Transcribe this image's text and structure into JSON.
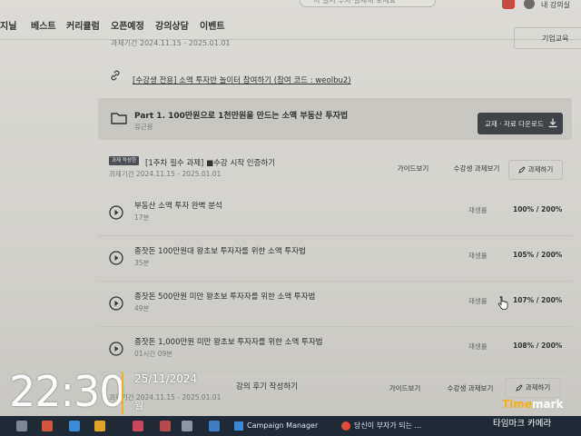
{
  "nav": {
    "items": [
      "지닐",
      "베스트",
      "커리큘럼",
      "오픈예정",
      "강의상담",
      "이벤트"
    ],
    "search_placeholder": "이 일시 투자 실제해 보세요",
    "username": "내 강의실"
  },
  "top_task": {
    "period": "과제기간 2024.11.15 - 2025.01.01",
    "corp_button": "기업교육"
  },
  "event_link": "[수강생 전용] 소액 투자반 놀이터 참여하기 (참여 코드 : weolbu2)",
  "part": {
    "title": "Part 1. 100만원으로 1천만원을 만드는 소액 부동산 투자법",
    "subtitle": "유근용",
    "download_label": "교재 · 자료 다운로드"
  },
  "task1": {
    "badge": "과제 작성한",
    "title": "[1주차 필수 과제] ■수강 시작 인증하기",
    "period": "과제기간 2024.11.15 - 2025.01.01",
    "guide_label": "가이드보기",
    "view_label": "수강생 과제보기",
    "submit_label": "과제하기"
  },
  "lessons": [
    {
      "title": "부동산 소액 투자 완벽 분석",
      "duration": "17분",
      "replay": "재생률",
      "rate": "100% / 200%"
    },
    {
      "title": "종잣돈 100만원대 왕초보 투자자를 위한 소액 투자법",
      "duration": "35분",
      "replay": "재생률",
      "rate": "105% / 200%"
    },
    {
      "title": "종잣돈 500만원 미만 왕초보 투자자를 위한 소액 투자법",
      "duration": "49분",
      "replay": "재생률",
      "rate": "107% / 200%"
    },
    {
      "title": "종잣돈 1,000만원 미만 왕초보 투자자를 위한 소액 투자법",
      "duration": "01시간 09분",
      "replay": "재생률",
      "rate": "108% / 200%"
    }
  ],
  "task2": {
    "title": "강의 후기 작성하기",
    "period": "과제기간 2024.11.15 - 2025.01.01",
    "guide_label": "가이드보기",
    "view_label": "수강생 과제보기",
    "submit_label": "과제하기"
  },
  "taskbar": {
    "app1": "Campaign Manager",
    "app2": "당신이 부자가 되는 ..."
  },
  "timestamp": {
    "time": "22:30",
    "date": "25/11/2024",
    "day": "월",
    "brand_accent": "Time",
    "brand_rest": "mark",
    "brand_sub": "타임마크 카메라"
  },
  "colors": {
    "download_bg": "#3f4347",
    "badge_bg": "#4b4f54",
    "taskbar_bg": "#1f2a36",
    "timemark_accent": "#f0b21a"
  }
}
